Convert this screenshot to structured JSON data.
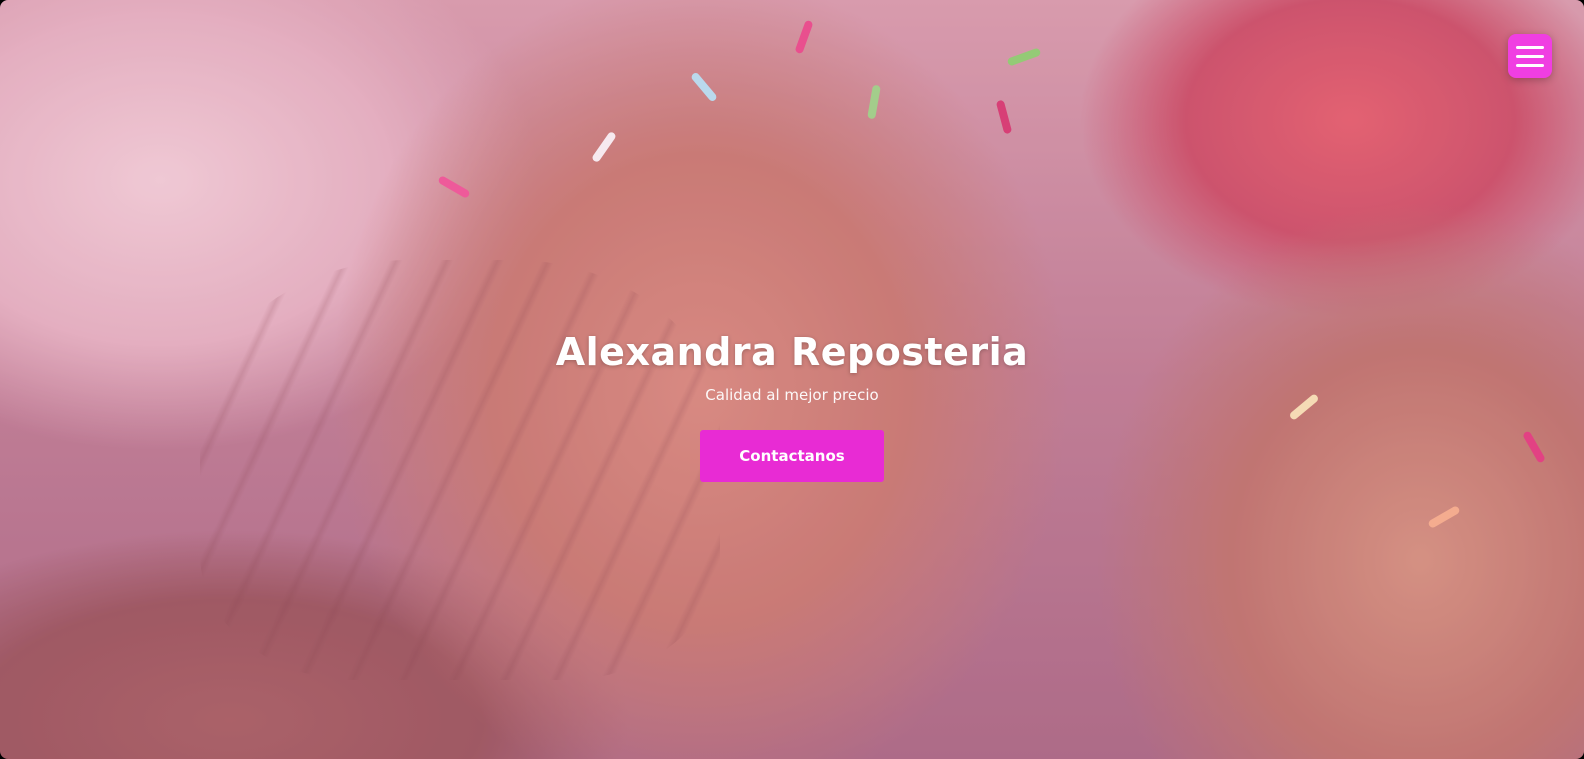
{
  "hero": {
    "title": "Alexandra Reposteria",
    "subtitle": "Calidad al mejor precio",
    "cta_label": "Contactanos",
    "background_image": "muffins-with-sprinkles"
  },
  "nav": {
    "menu_icon": "hamburger-menu-icon"
  },
  "colors": {
    "accent": "#e82bd4",
    "menu_button": "#f03ee2",
    "text": "#ffffff"
  }
}
